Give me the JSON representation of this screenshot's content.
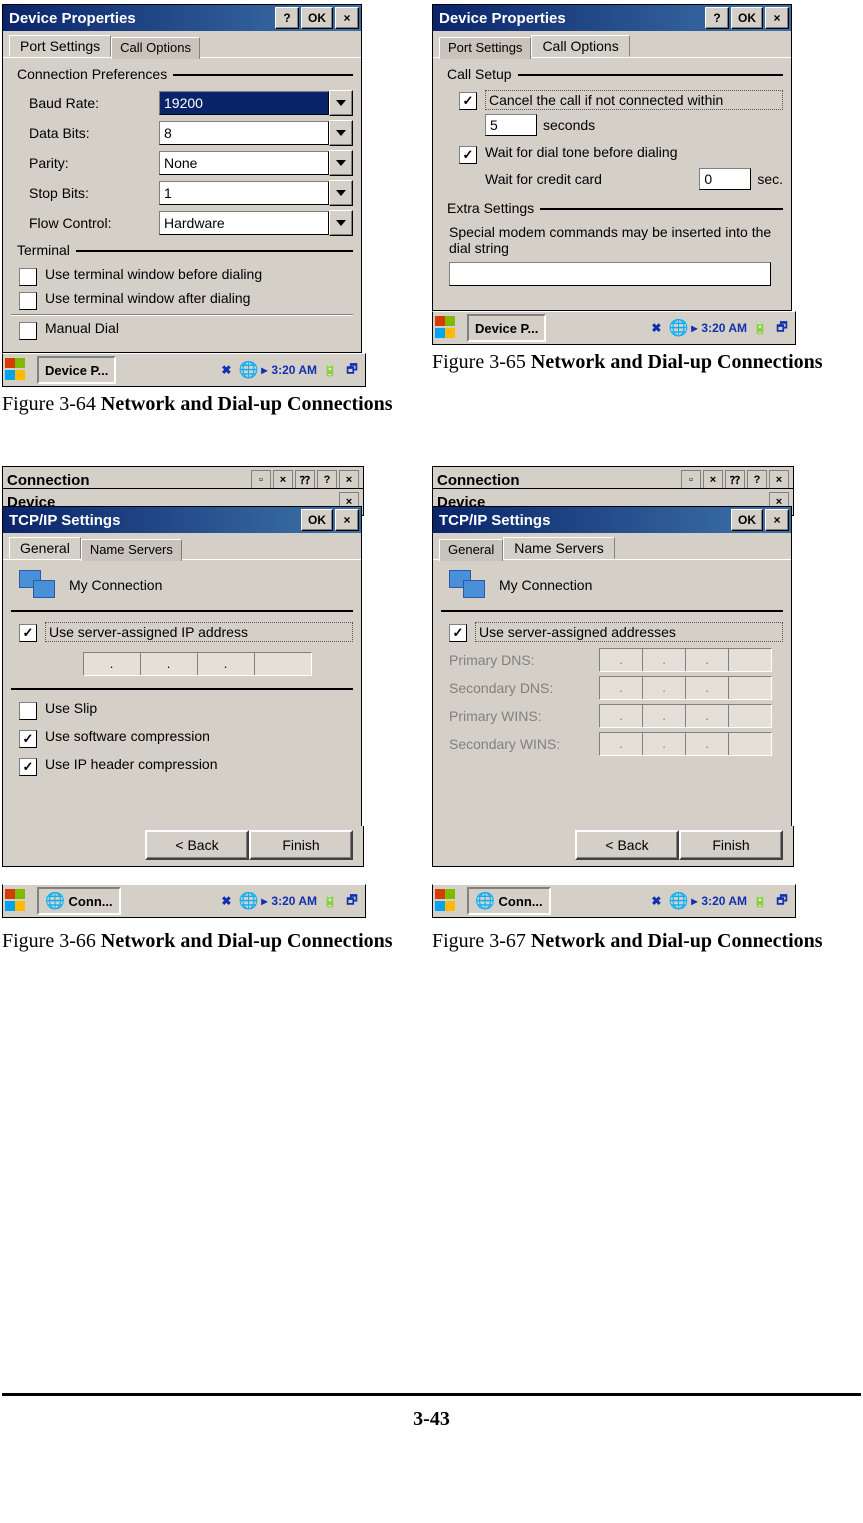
{
  "page_number": "3-43",
  "figures": {
    "a": {
      "num": "Figure 3-64",
      "title": "Network and Dial-up Connections"
    },
    "b": {
      "num": "Figure 3-65",
      "title": "Network and Dial-up Connections"
    },
    "c": {
      "num": "Figure 3-66",
      "title": "Network and Dial-up Connections"
    },
    "d": {
      "num": "Figure 3-67",
      "title": "Network and Dial-up Connections"
    }
  },
  "win_a": {
    "title": "Device Properties",
    "btn_help": "?",
    "btn_ok": "OK",
    "btn_close": "×",
    "tab_active": "Port Settings",
    "tab_inactive": "Call Options",
    "group1": "Connection Preferences",
    "baud_lbl": "Baud Rate:",
    "baud_val": "19200",
    "databits_lbl": "Data Bits:",
    "databits_val": "8",
    "parity_lbl": "Parity:",
    "parity_val": "None",
    "stopbits_lbl": "Stop Bits:",
    "stopbits_val": "1",
    "flow_lbl": "Flow Control:",
    "flow_val": "Hardware",
    "group2": "Terminal",
    "chk1": "Use terminal window before dialing",
    "chk2": "Use terminal window after dialing",
    "chk3": "Manual Dial"
  },
  "win_b": {
    "title": "Device Properties",
    "tab_inactive": "Port Settings",
    "tab_active": "Call Options",
    "group1": "Call Setup",
    "chk1": "Cancel the call if not connected within",
    "seconds_val": "5",
    "seconds_lbl": "seconds",
    "chk2": "Wait for dial tone before dialing",
    "cc_lbl": "Wait for credit card",
    "cc_val": "0",
    "cc_unit": "sec.",
    "group2": "Extra Settings",
    "extra_txt": "Special modem commands may be inserted into the dial string"
  },
  "win_c": {
    "bg1": "Connection",
    "bg2": "Device",
    "title": "TCP/IP Settings",
    "tab_active": "General",
    "tab_inactive": "Name Servers",
    "conn_name": "My Connection",
    "chk1": "Use server-assigned IP address",
    "chk2": "Use Slip",
    "chk3": "Use software compression",
    "chk4": "Use IP header compression",
    "btn_back": "< Back",
    "btn_finish": "Finish"
  },
  "win_d": {
    "title": "TCP/IP Settings",
    "tab_inactive": "General",
    "tab_active": "Name Servers",
    "conn_name": "My Connection",
    "chk1": "Use server-assigned addresses",
    "dns1": "Primary DNS:",
    "dns2": "Secondary DNS:",
    "wins1": "Primary WINS:",
    "wins2": "Secondary WINS:",
    "btn_back": "< Back",
    "btn_finish": "Finish"
  },
  "taskbar": {
    "task_a": "Device P...",
    "task_c": "Conn...",
    "time": "3:20 AM",
    "arrow": "▸"
  }
}
